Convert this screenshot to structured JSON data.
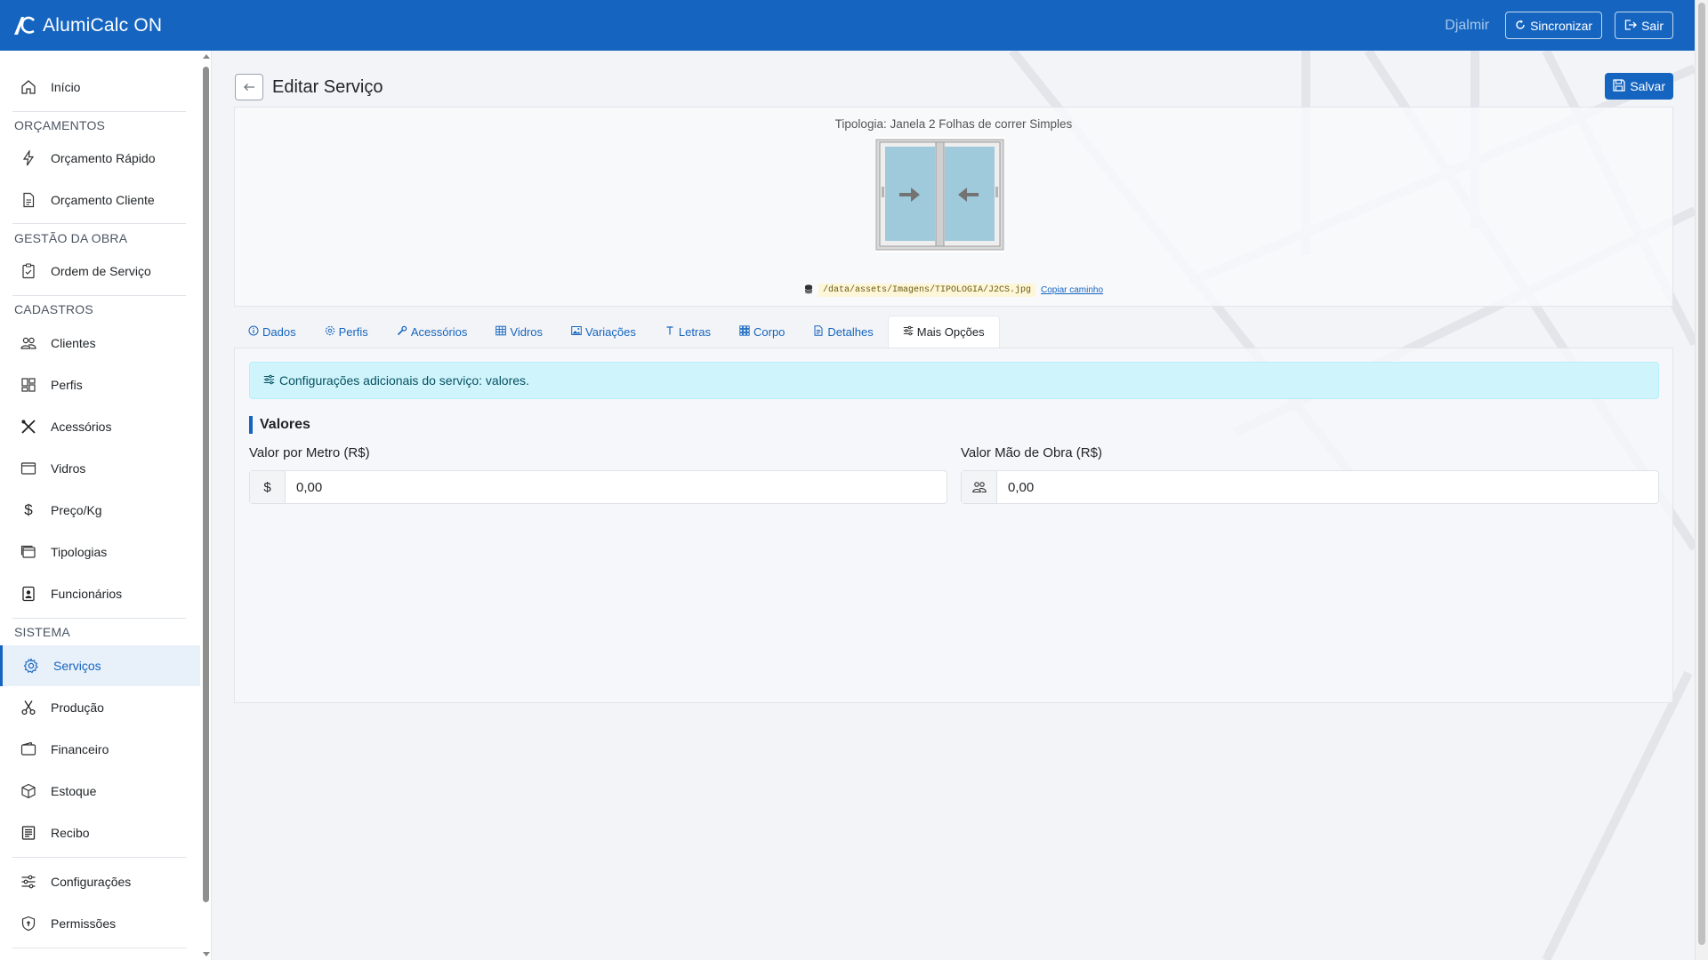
{
  "app": {
    "name": "AlumiCalc ON"
  },
  "topbar": {
    "user": "Djalmir",
    "sync_label": "Sincronizar",
    "logout_label": "Sair"
  },
  "sidebar": {
    "home": "Início",
    "sections": {
      "orcamentos": "ORÇAMENTOS",
      "gestao": "GESTÃO DA OBRA",
      "cadastros": "CADASTROS",
      "sistema": "SISTEMA"
    },
    "items": {
      "orcamento_rapido": "Orçamento Rápido",
      "orcamento_cliente": "Orçamento Cliente",
      "ordem_servico": "Ordem de Serviço",
      "clientes": "Clientes",
      "perfis": "Perfis",
      "acessorios": "Acessórios",
      "vidros": "Vidros",
      "preco_kg": "Preço/Kg",
      "tipologias": "Tipologias",
      "funcionarios": "Funcionários",
      "servicos": "Serviços",
      "producao": "Produção",
      "financeiro": "Financeiro",
      "estoque": "Estoque",
      "recibo": "Recibo",
      "configuracoes": "Configurações",
      "permissoes": "Permissões"
    },
    "active": "servicos"
  },
  "page": {
    "title": "Editar Serviço",
    "save_label": "Salvar"
  },
  "preview": {
    "tipologia": "Tipologia: Janela 2 Folhas de correr Simples",
    "path": "/data/assets/Imagens/TIPOLOGIA/J2CS.jpg",
    "copy_label": "Copiar caminho"
  },
  "tabs": [
    {
      "label": "Dados",
      "icon": "info-icon"
    },
    {
      "label": "Perfis",
      "icon": "gear-icon"
    },
    {
      "label": "Acessórios",
      "icon": "wrench-icon"
    },
    {
      "label": "Vidros",
      "icon": "grid-icon"
    },
    {
      "label": "Variações",
      "icon": "image-icon"
    },
    {
      "label": "Letras",
      "icon": "text-icon"
    },
    {
      "label": "Corpo",
      "icon": "grid-dots-icon"
    },
    {
      "label": "Detalhes",
      "icon": "document-icon"
    },
    {
      "label": "Mais Opções",
      "icon": "sliders-icon"
    }
  ],
  "active_tab": "Mais Opções",
  "panel": {
    "alert": "Configurações adicionais do serviço: valores.",
    "section_title": "Valores",
    "field_metro": {
      "label": "Valor por Metro (R$)",
      "prefix": "$",
      "value": "0,00"
    },
    "field_mao_obra": {
      "label": "Valor Mão de Obra (R$)",
      "value": "0,00"
    }
  },
  "colors": {
    "primary": "#1565c0",
    "alert_bg": "#cff4fc",
    "alert_text": "#055160"
  }
}
